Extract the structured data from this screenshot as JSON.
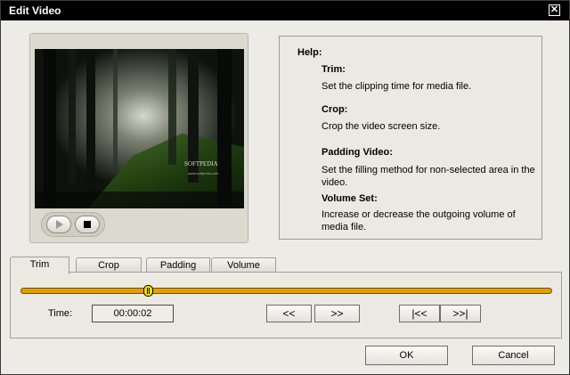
{
  "window": {
    "title": "Edit Video",
    "close_glyph": "✕"
  },
  "player": {
    "overlay_brand": "SOFTPEDIA",
    "overlay_url": "www.softpedia.com",
    "play_icon": "play-icon",
    "stop_icon": "stop-icon"
  },
  "help": {
    "heading": "Help:",
    "sections": [
      {
        "title": "Trim:",
        "text": "Set the clipping time for media file."
      },
      {
        "title": "Crop:",
        "text": "Crop the video screen size."
      },
      {
        "title": "Padding Video:",
        "text": "Set the filling method for non-selected area in the video."
      },
      {
        "title": "Volume Set:",
        "text": "Increase or decrease the outgoing volume of media file."
      }
    ]
  },
  "tabs": [
    {
      "label": "Trim",
      "active": true
    },
    {
      "label": "Crop",
      "active": false
    },
    {
      "label": "Padding",
      "active": false
    },
    {
      "label": "Volume",
      "active": false
    }
  ],
  "trim": {
    "time_label": "Time:",
    "time_value": "00:00:02",
    "slider_position_fraction": 0.24,
    "rewind_label": "<<",
    "forward_label": ">>",
    "mark_start_label": "|<<",
    "mark_end_label": ">>|"
  },
  "footer": {
    "ok_label": "OK",
    "cancel_label": "Cancel"
  },
  "colors": {
    "slider": "#e0a000",
    "thumb": "#f0e000",
    "titlebar": "#000000"
  }
}
